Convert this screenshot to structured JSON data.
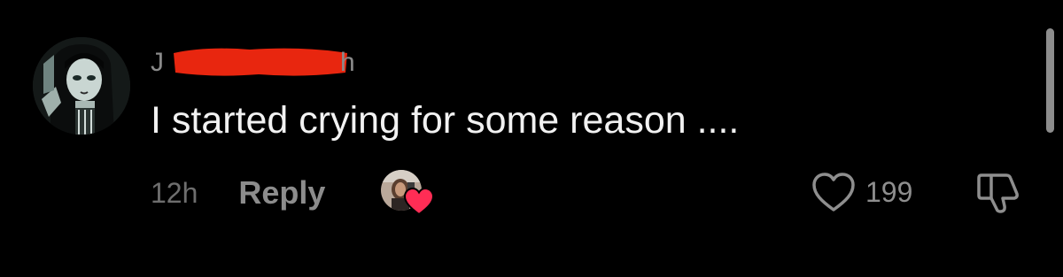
{
  "comment": {
    "username_visible": "J",
    "username_tail": "h",
    "text": "I started crying for some reason ....",
    "time": "12h",
    "reply_label": "Reply",
    "like_count": "199"
  },
  "icons": {
    "avatar": "avatar-image",
    "liker": "liker-avatar",
    "liker_badge": "heart-icon",
    "like": "heart-outline-icon",
    "dislike": "thumbs-down-icon"
  },
  "colors": {
    "background": "#000000",
    "redaction": "#e8260f",
    "liker_heart": "#ff2d55"
  }
}
